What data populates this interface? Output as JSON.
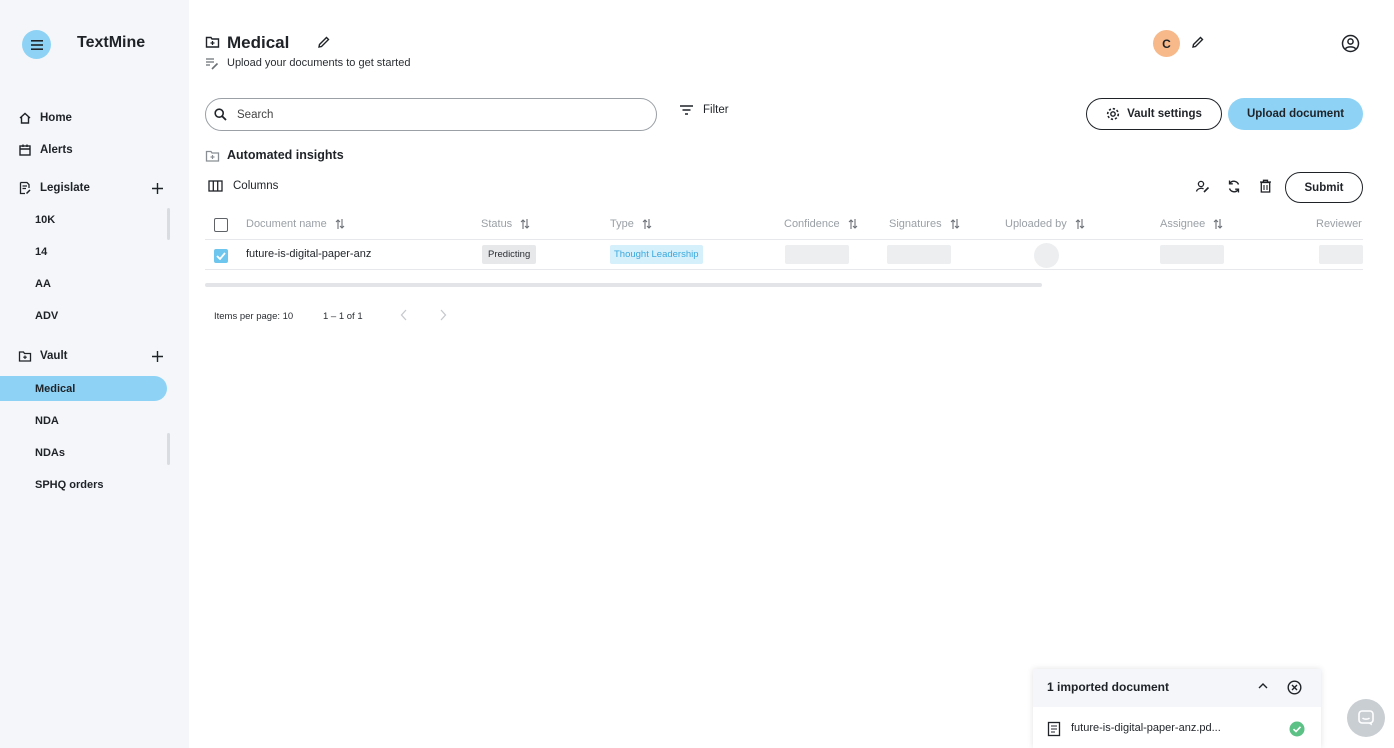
{
  "app": {
    "name": "TextMine"
  },
  "sidebar": {
    "home": "Home",
    "alerts": "Alerts",
    "legislate": {
      "label": "Legislate",
      "items": [
        "10K",
        "14",
        "AA",
        "ADV"
      ]
    },
    "vault": {
      "label": "Vault",
      "items": [
        "Medical",
        "NDA",
        "NDAs",
        "SPHQ orders"
      ],
      "active": "Medical"
    }
  },
  "header": {
    "title": "Medical",
    "subtitle": "Upload your documents to get started",
    "avatar_initial": "C"
  },
  "toolbar": {
    "search_placeholder": "Search",
    "filter_label": "Filter",
    "vault_settings_label": "Vault settings",
    "upload_label": "Upload document",
    "insights_label": "Automated insights",
    "columns_label": "Columns",
    "submit_label": "Submit"
  },
  "table": {
    "columns": [
      "Document name",
      "Status",
      "Type",
      "Confidence",
      "Signatures",
      "Uploaded by",
      "Assignee",
      "Reviewer"
    ],
    "rows": [
      {
        "name": "future-is-digital-paper-anz",
        "status": "Predicting",
        "type": "Thought Leadership",
        "checked": true
      }
    ]
  },
  "pagination": {
    "items_per_page": "Items per page: 10",
    "range": "1 – 1 of 1"
  },
  "import_panel": {
    "title": "1 imported document",
    "file": "future-is-digital-paper-anz.pd..."
  },
  "colors": {
    "accent": "#8ed3f5",
    "sidebar_bg": "#f4f6f9",
    "avatar": "#f7b98a",
    "success": "#5cc185"
  }
}
